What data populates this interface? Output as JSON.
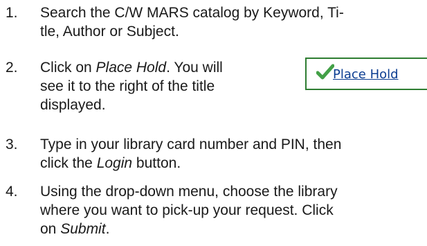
{
  "steps": [
    {
      "number": "1.",
      "lines": [
        "Search the C/W MARS catalog by Keyword, Ti-",
        "tle, Author or Subject."
      ]
    },
    {
      "number": "2.",
      "line1_pre": "Click on ",
      "line1_em": "Place Hold",
      "line1_post": ".  You will",
      "line2": "see it  to the right of the title",
      "line3": "displayed."
    },
    {
      "number": "3.",
      "line1": "Type in your library card number and PIN, then",
      "line2_pre": "click the ",
      "line2_em": "Login",
      "line2_post": " button."
    },
    {
      "number": "4.",
      "line1": "Using the drop-down menu, choose the library",
      "line2": "where you want to pick-up your request.  Click",
      "line3_pre": "on ",
      "line3_em": "Submit",
      "line3_post": "."
    }
  ],
  "place_hold_image": {
    "label": "Place Hold",
    "icon": "checkmark-icon",
    "accent_color": "#2e7d32",
    "link_color": "#0b3d91"
  }
}
